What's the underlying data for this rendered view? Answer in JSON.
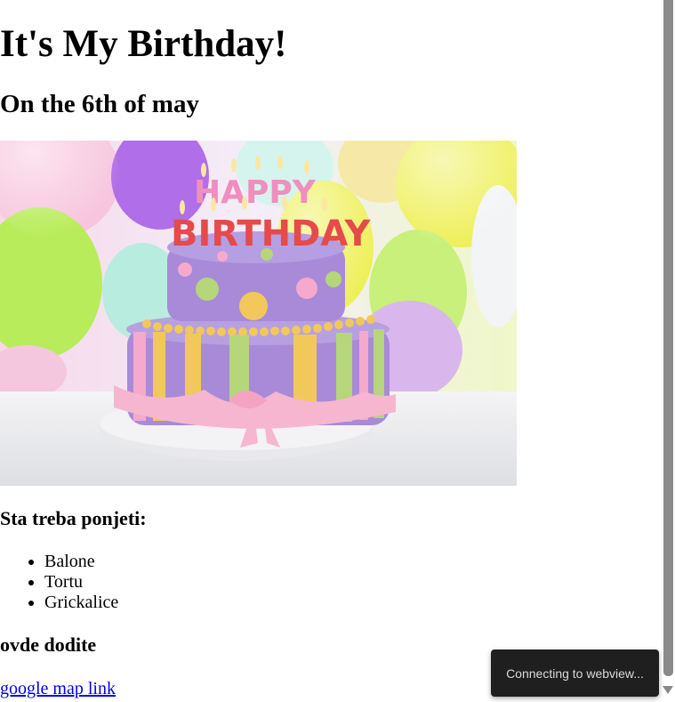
{
  "page": {
    "title": "It's My Birthday!",
    "subtitle": "On the 6th of may",
    "bring_heading": "Sta treba ponjeti:",
    "bring_items": [
      "Balone",
      "Tortu",
      "Grickalice"
    ],
    "come_heading": "ovde dodite",
    "map_link_label": "google map link"
  },
  "hero_image": {
    "cake_topper_line1": "HAPPY",
    "cake_topper_line2": "BIRTHDAY",
    "colors": {
      "balloon_purple": "#b06ee8",
      "balloon_yellow": "#eef05a",
      "balloon_green": "#b9ec5a",
      "cake_purple": "#a98ad8",
      "stripe_yellow": "#f2c85a",
      "stripe_green": "#b5d67a",
      "stripe_pink": "#f5a9cd",
      "bow_pink": "#f7b6cf"
    }
  },
  "overlay": {
    "toast_text": "Connecting to webview..."
  },
  "icons": {
    "scroll_down": "scroll-down-arrow-icon",
    "bullet": "disc-bullet-icon"
  }
}
